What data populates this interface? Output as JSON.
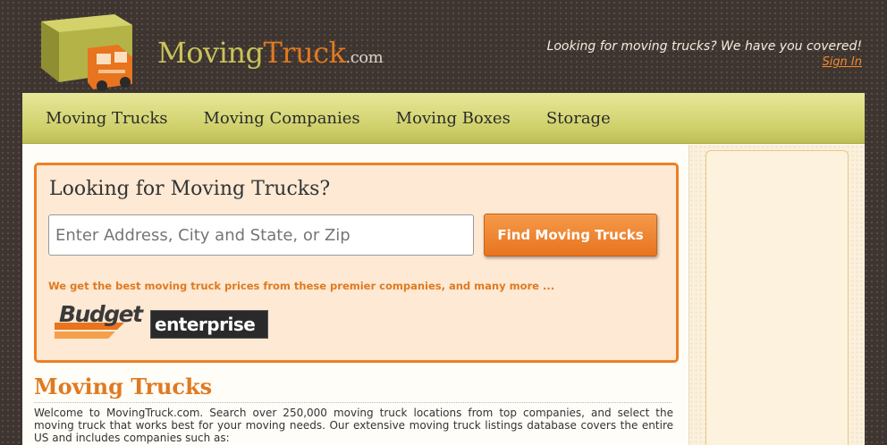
{
  "header": {
    "logo": {
      "moving": "Moving",
      "truck": "Truck",
      "com": ".com"
    },
    "tagline": "Looking for moving trucks? We have you covered!",
    "signin_label": "Sign In"
  },
  "nav": {
    "items": [
      {
        "label": "Moving Trucks"
      },
      {
        "label": "Moving Companies"
      },
      {
        "label": "Moving Boxes"
      },
      {
        "label": "Storage"
      }
    ]
  },
  "search": {
    "title": "Looking for Moving Trucks?",
    "input_placeholder": "Enter Address, City and State, or Zip",
    "button_label": "Find Moving Trucks",
    "promo_text": "We get the best moving truck prices from these premier companies, and many more ...",
    "partners": [
      "Budget",
      "enterprise"
    ]
  },
  "content": {
    "section_title": "Moving Trucks",
    "body": "Welcome to MovingTruck.com. Search over 250,000 moving truck locations from top companies, and select the moving truck that works best for your moving needs. Our extensive moving truck listings database covers the entire US and includes companies such as:"
  },
  "colors": {
    "brand_orange": "#e07a20",
    "brand_olive": "#c9c45a",
    "nav_bg": "#cfd06a",
    "background": "#3e3531"
  }
}
